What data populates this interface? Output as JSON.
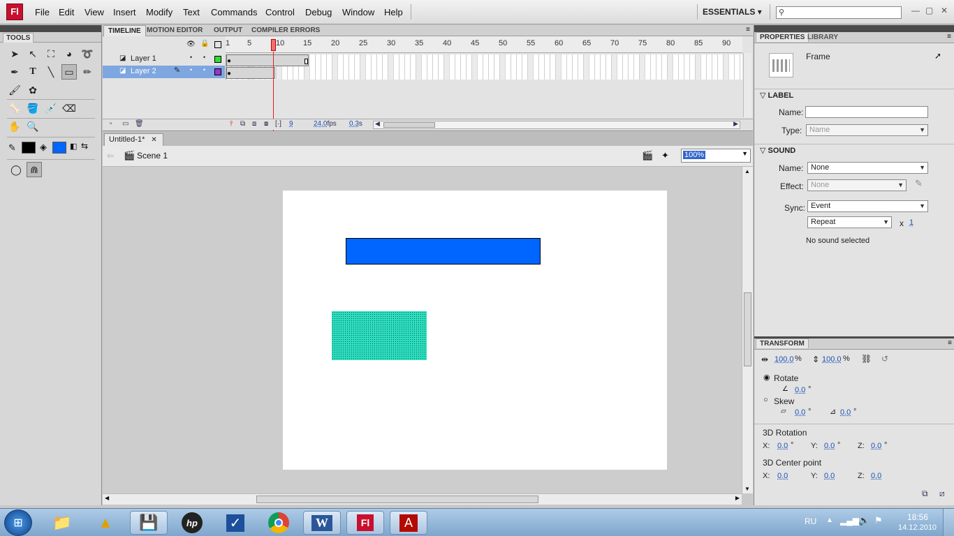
{
  "app": {
    "logo": "Fl"
  },
  "menu": [
    "File",
    "Edit",
    "View",
    "Insert",
    "Modify",
    "Text",
    "Commands",
    "Control",
    "Debug",
    "Window",
    "Help"
  ],
  "workspace": "ESSENTIALS",
  "tools_panel": {
    "title": "TOOLS"
  },
  "timeline": {
    "tabs": [
      "TIMELINE",
      "MOTION EDITOR",
      "OUTPUT",
      "COMPILER ERRORS"
    ],
    "ruler": [
      "1",
      "5",
      "10",
      "15",
      "20",
      "25",
      "30",
      "35",
      "40",
      "45",
      "50",
      "55",
      "60",
      "65",
      "70",
      "75",
      "80",
      "85",
      "90"
    ],
    "layers": [
      {
        "name": "Layer 1",
        "color": "#33dd33"
      },
      {
        "name": "Layer 2",
        "color": "#9933cc"
      }
    ],
    "status": {
      "frame": "9",
      "fps_value": "24.0",
      "fps_unit": "fps",
      "time_value": "0.3",
      "time_unit": "s"
    }
  },
  "document": {
    "tab": "Untitled-1*",
    "scene": "Scene 1",
    "zoom": "100%"
  },
  "stage_colors": {
    "blue_rect": "#0066ff",
    "teal_rect": "#2ee0c0",
    "stroke": "#000000",
    "fill": "#0066ff"
  },
  "properties": {
    "tabs": [
      "PROPERTIES",
      "LIBRARY"
    ],
    "type": "Frame",
    "label_section": "LABEL",
    "name_label": "Name:",
    "name_value": "",
    "type_label": "Type:",
    "type_value": "Name",
    "sound_section": "SOUND",
    "sound_name_value": "None",
    "effect_label": "Effect:",
    "effect_value": "None",
    "sync_label": "Sync:",
    "sync_value": "Event",
    "repeat_value": "Repeat",
    "repeat_x": "x",
    "repeat_count": "1",
    "no_sound": "No sound selected"
  },
  "transform": {
    "title": "TRANSFORM",
    "width_pct": "100.0",
    "height_pct": "100.0",
    "pct_unit": "%",
    "rotate_label": "Rotate",
    "rotate_value": "0.0",
    "skew_label": "Skew",
    "skew_h": "0.0",
    "skew_v": "0.0",
    "deg": "°",
    "rot3d_label": "3D Rotation",
    "rot3d": {
      "x": "0.0",
      "y": "0.0",
      "z": "0.0"
    },
    "center3d_label": "3D Center point",
    "center3d": {
      "x": "0.0",
      "y": "0.0",
      "z": "0.0"
    },
    "x_label": "X:",
    "y_label": "Y:",
    "z_label": "Z:"
  },
  "taskbar": {
    "lang": "RU",
    "time": "18:56",
    "date": "14.12.2010"
  }
}
